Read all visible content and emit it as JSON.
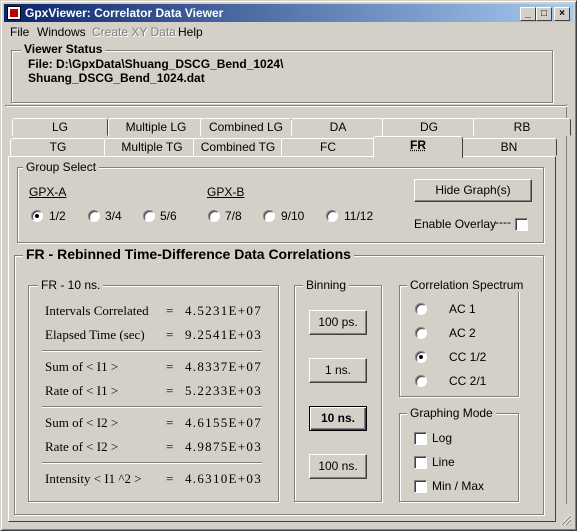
{
  "window": {
    "title": "GpxViewer: Correlator Data Viewer"
  },
  "titlebar_buttons": [
    "_",
    "□",
    "×"
  ],
  "menu": [
    {
      "label": "File",
      "enabled": true
    },
    {
      "label": "Windows",
      "enabled": true
    },
    {
      "label": "Create XY Data",
      "enabled": false
    },
    {
      "label": "Help",
      "enabled": true
    }
  ],
  "viewer_status": {
    "label": "Viewer  Status",
    "file_line1": "File: D:\\GpxData\\Shuang_DSCG_Bend_1024\\",
    "file_line2": "Shuang_DSCG_Bend_1024.dat"
  },
  "tabs_row_back": [
    "LG",
    "Multiple LG",
    "Combined LG",
    "DA",
    "DG",
    "RB"
  ],
  "tabs_row_front": [
    "TG",
    "Multiple TG",
    "Combined TG",
    "FC",
    "FR",
    "BN"
  ],
  "active_tab": "FR",
  "group_select": {
    "label": "Group Select",
    "gpx_a": "GPX-A",
    "gpx_b": "GPX-B",
    "options": [
      "1/2",
      "3/4",
      "5/6",
      "7/8",
      "9/10",
      "11/12"
    ],
    "selected": "1/2",
    "hide_graphs": "Hide Graph(s)",
    "enable_overlay": "Enable Overlay",
    "overlay_dash": "----"
  },
  "fr_section": {
    "title": "FR - Rebinned Time-Difference Data Correlations",
    "box_label": "FR - 10 ns.",
    "rows": [
      {
        "label": "Intervals Correlated",
        "eq": "=",
        "value": "4.5231E+07"
      },
      {
        "label": "Elapsed Time  (sec)",
        "eq": "=",
        "value": "9.2541E+03"
      },
      {
        "label": "Sum of  < I1 >",
        "eq": "=",
        "value": "4.8337E+07"
      },
      {
        "label": "Rate of  < I1 >",
        "eq": "=",
        "value": "5.2233E+03"
      },
      {
        "label": "Sum of  < I2 >",
        "eq": "=",
        "value": "4.6155E+07"
      },
      {
        "label": "Rate of  < I2 >",
        "eq": "=",
        "value": "4.9875E+03"
      },
      {
        "label": "Intensity  < I1 ^2 >",
        "eq": "=",
        "value": "4.6310E+03"
      }
    ]
  },
  "binning": {
    "label": "Binning",
    "buttons": [
      "100 ps.",
      "1 ns.",
      "10 ns.",
      "100 ns."
    ],
    "selected": "10 ns."
  },
  "correlation_spectrum": {
    "label": "Correlation Spectrum",
    "options": [
      "AC  1",
      "AC  2",
      "CC  1/2",
      "CC  2/1"
    ],
    "selected": "CC  1/2"
  },
  "graphing_mode": {
    "label": "Graphing  Mode",
    "options": [
      "Log",
      "Line",
      "Min / Max"
    ]
  }
}
